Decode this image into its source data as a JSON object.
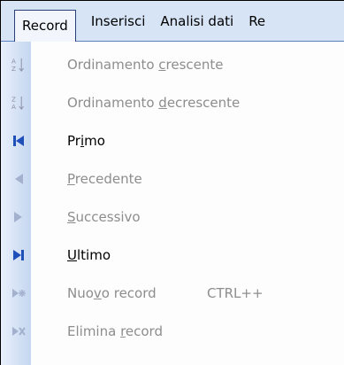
{
  "menubar": {
    "items": [
      {
        "label": "Record",
        "active": true
      },
      {
        "label": "Inserisci"
      },
      {
        "label": "Analisi dati"
      },
      {
        "label": "Re"
      }
    ]
  },
  "menu": {
    "items": [
      {
        "pre": "Ordinamento ",
        "ul": "c",
        "post": "rescente",
        "shortcut": "",
        "enabled": false,
        "icon": "sort-ascending-icon"
      },
      {
        "pre": "Ordinamento ",
        "ul": "d",
        "post": "ecrescente",
        "shortcut": "",
        "enabled": false,
        "icon": "sort-descending-icon"
      },
      {
        "pre": "Pr",
        "ul": "i",
        "post": "mo",
        "shortcut": "",
        "enabled": true,
        "icon": "first-record-icon"
      },
      {
        "pre": "",
        "ul": "P",
        "post": "recedente",
        "shortcut": "",
        "enabled": false,
        "icon": "previous-record-icon"
      },
      {
        "pre": "",
        "ul": "S",
        "post": "uccessivo",
        "shortcut": "",
        "enabled": false,
        "icon": "next-record-icon"
      },
      {
        "pre": "",
        "ul": "U",
        "post": "ltimo",
        "shortcut": "",
        "enabled": true,
        "icon": "last-record-icon"
      },
      {
        "pre": "Nuo",
        "ul": "v",
        "post": "o record",
        "shortcut": "CTRL++",
        "enabled": false,
        "icon": "new-record-icon"
      },
      {
        "pre": "Elimina ",
        "ul": "r",
        "post": "ecord",
        "shortcut": "",
        "enabled": false,
        "icon": "delete-record-icon"
      }
    ]
  }
}
